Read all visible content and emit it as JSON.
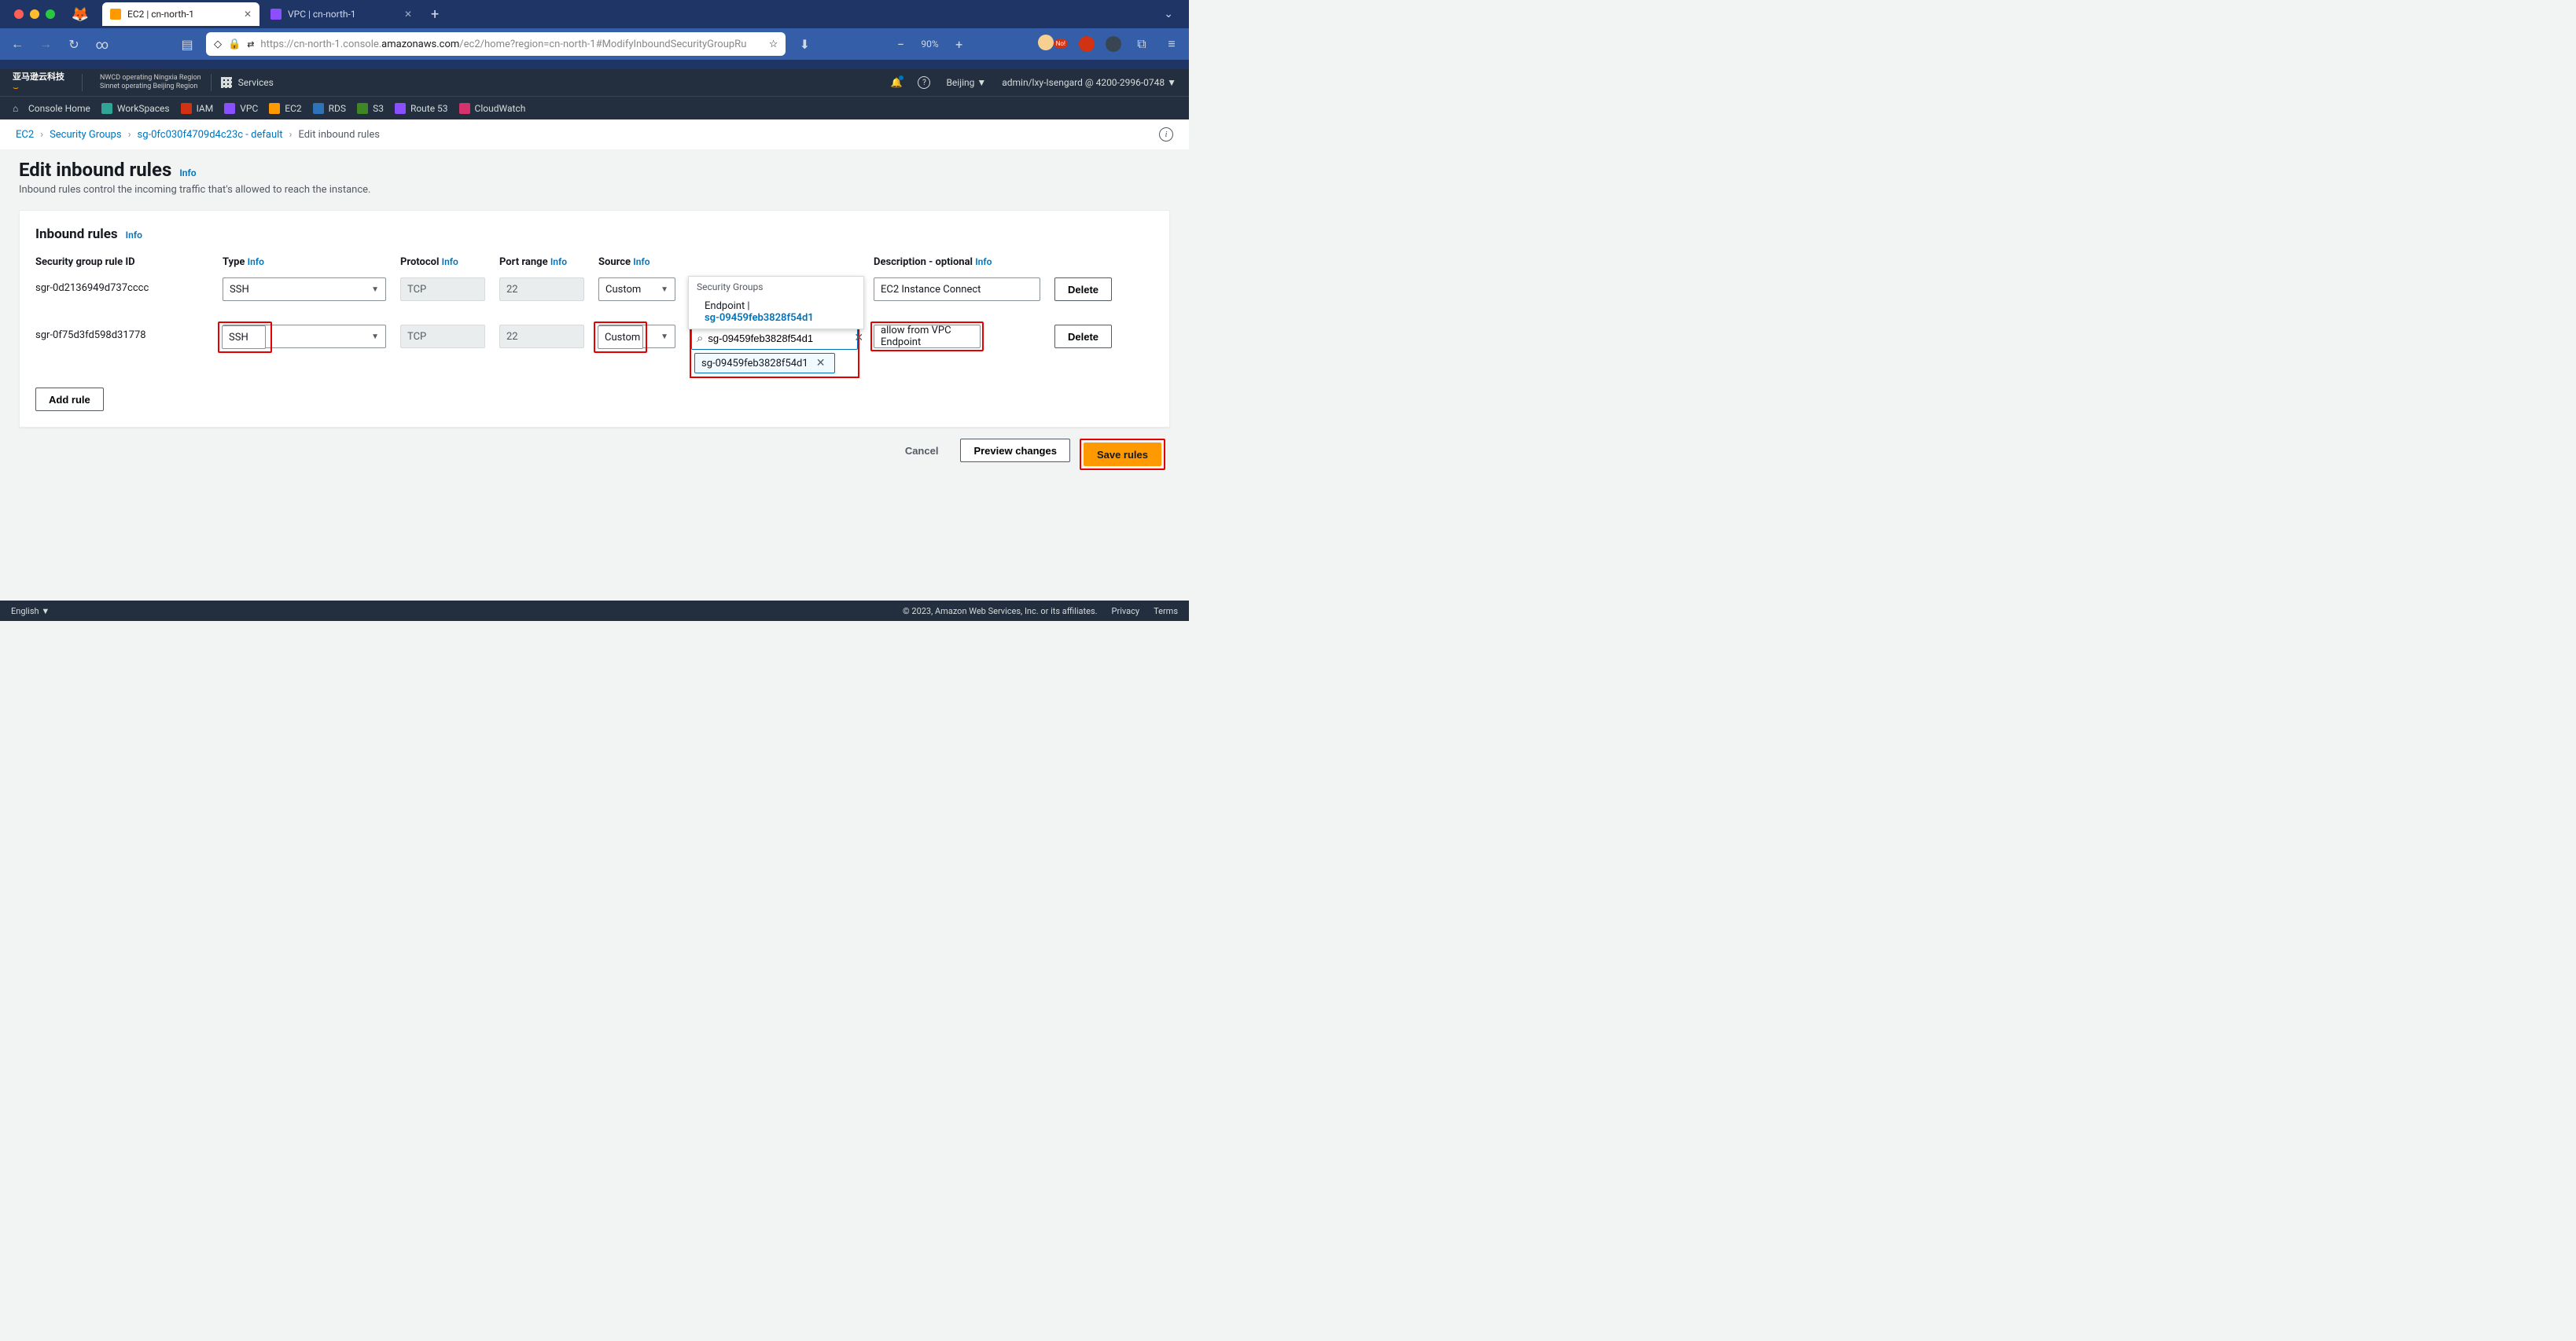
{
  "browser": {
    "tabs": [
      {
        "title": "EC2 | cn-north-1",
        "active": true
      },
      {
        "title": "VPC | cn-north-1",
        "active": false
      }
    ],
    "url_prefix": "https://cn-north-1.console.",
    "url_host": "amazonaws.com",
    "url_path": "/ec2/home?region=cn-north-1#ModifyInboundSecurityGroupRu",
    "zoom": "90%"
  },
  "aws_header": {
    "logo_cn": "亚马逊云科技",
    "logo_nwcd": "NWCD operating Ningxia Region",
    "logo_sinnet": "Sinnet operating Beijing Region",
    "services": "Services",
    "region": "Beijing",
    "account": "admin/lxy-Isengard @ 4200-2996-0748"
  },
  "favorites": [
    {
      "label": "Console Home",
      "color": "#545b64"
    },
    {
      "label": "WorkSpaces",
      "color": "#2ea597"
    },
    {
      "label": "IAM",
      "color": "#d13212"
    },
    {
      "label": "VPC",
      "color": "#8c4fff"
    },
    {
      "label": "EC2",
      "color": "#ff9900"
    },
    {
      "label": "RDS",
      "color": "#2e73b8"
    },
    {
      "label": "S3",
      "color": "#3f8624"
    },
    {
      "label": "Route 53",
      "color": "#8c4fff"
    },
    {
      "label": "CloudWatch",
      "color": "#d6336c"
    }
  ],
  "breadcrumb": {
    "items": [
      "EC2",
      "Security Groups",
      "sg-0fc030f4709d4c23c - default",
      "Edit inbound rules"
    ]
  },
  "page": {
    "title": "Edit inbound rules",
    "info": "Info",
    "subtitle": "Inbound rules control the incoming traffic that's allowed to reach the instance."
  },
  "panel": {
    "title": "Inbound rules",
    "info": "Info",
    "headers": {
      "id": "Security group rule ID",
      "type": "Type",
      "protocol": "Protocol",
      "port": "Port range",
      "source": "Source",
      "desc": "Description - optional"
    },
    "rules": [
      {
        "id": "sgr-0d2136949d737cccc",
        "type": "SSH",
        "protocol": "TCP",
        "port": "22",
        "source_mode": "Custom",
        "source_value": "",
        "desc": "EC2 Instance Connect"
      },
      {
        "id": "sgr-0f75d3fd598d31778",
        "type": "SSH",
        "protocol": "TCP",
        "port": "22",
        "source_mode": "Custom",
        "source_value": "sg-09459feb3828f54d1",
        "source_tag": "sg-09459feb3828f54d1",
        "desc": "allow from VPC Endpoint"
      }
    ],
    "dropdown": {
      "header": "Security Groups",
      "item_label": "Endpoint |",
      "item_id": "sg-09459feb3828f54d1"
    },
    "add_rule": "Add rule",
    "delete": "Delete"
  },
  "actions": {
    "cancel": "Cancel",
    "preview": "Preview changes",
    "save": "Save rules"
  },
  "footer": {
    "lang": "English",
    "copyright": "© 2023, Amazon Web Services, Inc. or its affiliates.",
    "privacy": "Privacy",
    "terms": "Terms"
  }
}
